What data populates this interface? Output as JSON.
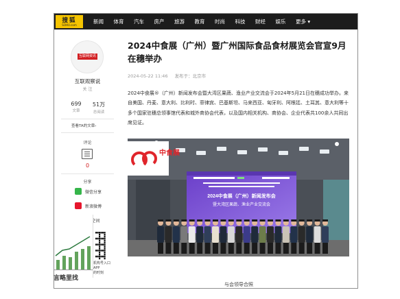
{
  "site": {
    "logo_text": "搜狐",
    "logo_sub": "SOHU.com",
    "nav": [
      "新闻",
      "体育",
      "汽车",
      "房产",
      "旅游",
      "教育",
      "时尚",
      "科技",
      "财经",
      "娱乐"
    ],
    "nav_more": "更多 ▾"
  },
  "author": {
    "badge": "互联网资讯",
    "name": "互联观察说",
    "subtitle": "关 注",
    "articles_count": "699",
    "articles_label": "文章",
    "reads_count": "51万",
    "reads_label": "总阅读",
    "all_articles": "查看TA的文章›"
  },
  "sidebar": {
    "comment_label": "评论",
    "comment_count": "0",
    "share_label": "分享",
    "share_items": [
      {
        "label": "微信分享",
        "color": "#35b54a"
      },
      {
        "label": "新浪微博",
        "color": "#e6162d"
      },
      {
        "label": "QQ空间",
        "color": "#f5a623"
      }
    ]
  },
  "article": {
    "title": "2024中食展（广州）暨广州国际食品食材展览会官宣9月在穗举办",
    "date": "2024-05-22 11:46",
    "source": "发布于：北京市",
    "body": "2024中食展®（广州）新闻发布会暨大湾区果蔬、渔业产业交流会于2024年5月21日在穗成功举办。来自美国、丹麦、意大利、比利时、菲律宾、巴基斯坦、马来西亚、匈牙利、阿根廷、土耳其、意大利等十多个国家驻穗总领事馆代表和城外商协会代表，以及国内相关机构、商协会、企业代表共100余人共同出席见证。",
    "caption": "与会领导合照"
  },
  "photo": {
    "brand_text": "中食展",
    "screen_title": "2024中食展（广州）新闻发布会",
    "screen_subtitle": "暨大湾区果蔬、渔业产业交流会"
  },
  "overlay": {
    "qr_caption_lines": [
      "机构号入口",
      "APP",
      "的时刻"
    ],
    "bottom_text": "言略里找"
  },
  "colors": {
    "topbar": "#1c1c1c",
    "logo": "#f5c400",
    "accent_red": "#d21f22",
    "stage_purple": "#7e5bd6"
  }
}
